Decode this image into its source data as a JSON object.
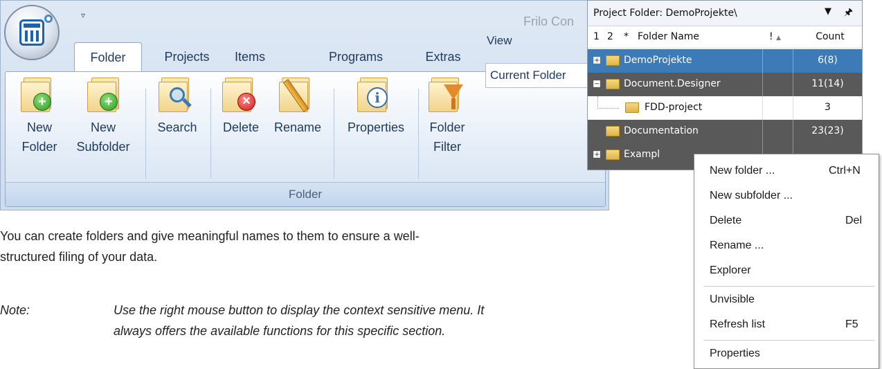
{
  "app": {
    "title": "Frilo Con",
    "qat_icon": "dropdown-arrow-icon"
  },
  "ribbon": {
    "tabs": [
      {
        "label": "Folder",
        "active": true
      },
      {
        "label": "Projects"
      },
      {
        "label": "Items"
      },
      {
        "label": "Programs"
      },
      {
        "label": "Extras"
      }
    ],
    "buttons": {
      "new_folder": [
        "New",
        "Folder"
      ],
      "new_subfolder": [
        "New",
        "Subfolder"
      ],
      "search": "Search",
      "delete": "Delete",
      "rename": "Rename",
      "properties": "Properties",
      "folder_filter": [
        "Folder",
        "Filter"
      ]
    },
    "view": {
      "label": "View",
      "value": "Current Folder"
    },
    "group_label": "Folder"
  },
  "panel": {
    "title": "Project Folder: DemoProjekte\\",
    "columns": {
      "c1": "1",
      "c2": "2",
      "c3": "*",
      "name": "Folder Name",
      "flag": "!",
      "count": "Count"
    },
    "rows": [
      {
        "name": "DemoProjekte",
        "count": "6(8)",
        "style": "sel",
        "expander": "+"
      },
      {
        "name": "Document.Designer",
        "count": "11(14)",
        "style": "dark",
        "expander": "−"
      },
      {
        "name": "FDD-project",
        "count": "3",
        "style": "plain",
        "expander": ""
      },
      {
        "name": "Documentation",
        "count": "23(23)",
        "style": "dark",
        "expander": ""
      },
      {
        "name": "Exampl",
        "count": "",
        "style": "dark",
        "expander": "+"
      }
    ]
  },
  "context_menu": {
    "items": [
      {
        "label": "New folder ...",
        "shortcut": "Ctrl+N"
      },
      {
        "label": "New subfolder ...",
        "shortcut": ""
      },
      {
        "label": "Delete",
        "shortcut": "Del"
      },
      {
        "label": "Rename ...",
        "shortcut": ""
      },
      {
        "label": "Explorer",
        "shortcut": ""
      },
      {
        "label": "Unvisible",
        "shortcut": ""
      },
      {
        "label": "Refresh list",
        "shortcut": "F5"
      },
      {
        "label": "Properties",
        "shortcut": ""
      }
    ]
  },
  "body": {
    "paragraph": [
      "You can create folders and give meaningful names to them to ensure a well-",
      "structured filing of your data."
    ],
    "note_label": "Note:",
    "note_text": [
      "Use the right mouse button to display the context sensitive menu. It",
      "always offers the available functions for this specific section."
    ]
  },
  "colors": {
    "selected_row": "#3c7ab8",
    "dark_row": "#595959",
    "ribbon_bg": "#dfe9f5"
  }
}
